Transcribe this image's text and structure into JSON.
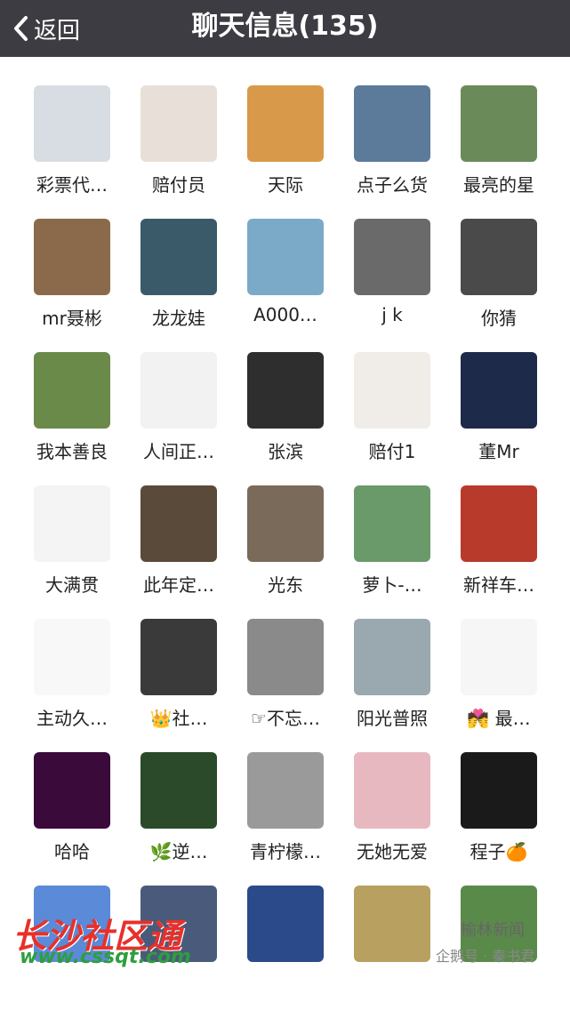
{
  "header": {
    "back_label": "返回",
    "title": "聊天信息(135)"
  },
  "members": [
    {
      "name": "彩票代…",
      "color": "#d8dde3"
    },
    {
      "name": "赔付员",
      "color": "#e8e0d8"
    },
    {
      "name": "天际",
      "color": "#d89a4a"
    },
    {
      "name": "点子么货",
      "color": "#5c7a9a"
    },
    {
      "name": "最亮的星",
      "color": "#6a8a5a"
    },
    {
      "name": "mr聂彬",
      "color": "#8a6a4a"
    },
    {
      "name": "龙龙娃",
      "color": "#3a5a6a"
    },
    {
      "name": "A000…",
      "color": "#7aaac8"
    },
    {
      "name": "j k",
      "color": "#6a6a6a"
    },
    {
      "name": "你猜",
      "color": "#4a4a4a"
    },
    {
      "name": "我本善良",
      "color": "#6a8a4a"
    },
    {
      "name": "人间正…",
      "color": "#f2f2f2"
    },
    {
      "name": "张滨",
      "color": "#2e2e2e"
    },
    {
      "name": "赔付1",
      "color": "#f0ece8"
    },
    {
      "name": "董Mr",
      "color": "#1e2a4a"
    },
    {
      "name": "大满贯",
      "color": "#f4f4f4"
    },
    {
      "name": "此年定…",
      "color": "#5a4a3a"
    },
    {
      "name": "光东",
      "color": "#7a6a5a"
    },
    {
      "name": "萝卜-…",
      "color": "#6a9a6a"
    },
    {
      "name": "新祥车…",
      "color": "#b83a2a"
    },
    {
      "name": "主动久…",
      "color": "#f8f8f8"
    },
    {
      "name": "👑社…",
      "color": "#3a3a3a"
    },
    {
      "name": "☞不忘…",
      "color": "#8a8a8a"
    },
    {
      "name": "阳光普照",
      "color": "#9aa8b0"
    },
    {
      "name": "💏 最…",
      "color": "#f6f6f6"
    },
    {
      "name": "哈哈",
      "color": "#3a0a3a"
    },
    {
      "name": "🌿逆…",
      "color": "#2a4a2a"
    },
    {
      "name": "青柠檬…",
      "color": "#9a9a9a"
    },
    {
      "name": "无她无爱",
      "color": "#e8b8c0"
    },
    {
      "name": "程子🍊",
      "color": "#1a1a1a"
    },
    {
      "name": "",
      "color": "#5a8ad8"
    },
    {
      "name": "",
      "color": "#4a5a7a"
    },
    {
      "name": "",
      "color": "#2a4a8a"
    },
    {
      "name": "",
      "color": "#b8a060"
    },
    {
      "name": "",
      "color": "#5a8a4a"
    }
  ],
  "watermark": {
    "site_name": "长沙社区通",
    "site_url": "www.cssqt.com",
    "wechat_name": "榆林新闻",
    "wechat_sub": "企鹅号 · 秦书君"
  }
}
